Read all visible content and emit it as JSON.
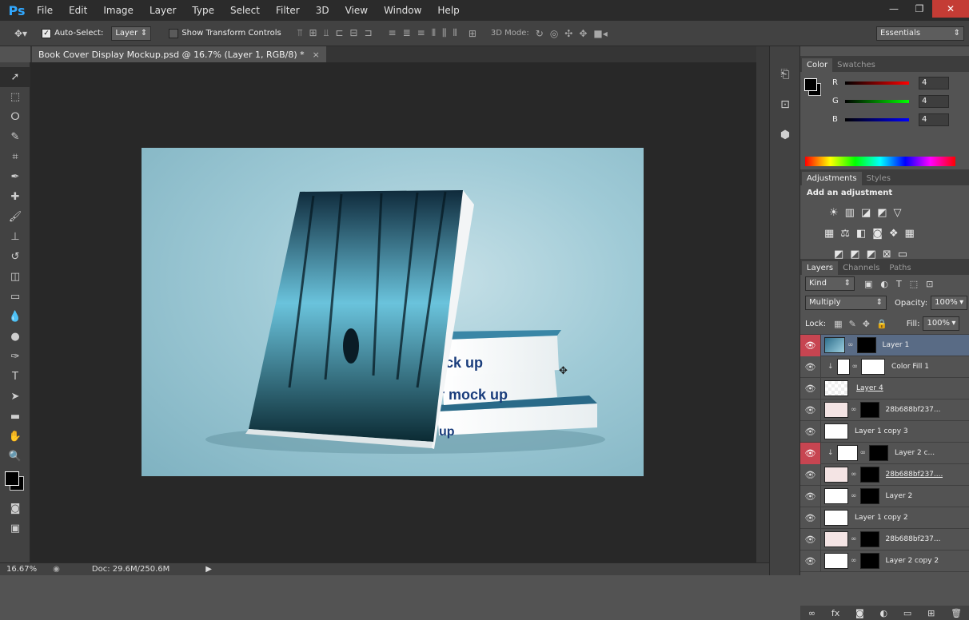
{
  "app": {
    "logo": "Ps"
  },
  "menu": [
    "File",
    "Edit",
    "Image",
    "Layer",
    "Type",
    "Select",
    "Filter",
    "3D",
    "View",
    "Window",
    "Help"
  ],
  "window_controls": {
    "minimize": "—",
    "restore": "❐",
    "close": "✕"
  },
  "options": {
    "auto_select_label": "Auto-Select:",
    "auto_select_value": "Layer",
    "show_transform_label": "Show Transform Controls",
    "mode_3d_label": "3D Mode:",
    "workspace": "Essentials"
  },
  "document": {
    "tab_title": "Book Cover Display Mockup.psd @ 16.7% (Layer 1, RGB/8) *",
    "close": "×"
  },
  "status": {
    "zoom": "16.67%",
    "doc_size": "Doc: 29.6M/250.6M"
  },
  "color_panel": {
    "tabs": [
      "Color",
      "Swatches"
    ],
    "channels": [
      {
        "label": "R",
        "value": "4",
        "color": "#e3342f"
      },
      {
        "label": "G",
        "value": "4",
        "color": "#2ecc40"
      },
      {
        "label": "B",
        "value": "4",
        "color": "#2c4bd8"
      }
    ]
  },
  "adjustments_panel": {
    "tabs": [
      "Adjustments",
      "Styles"
    ],
    "heading": "Add an adjustment"
  },
  "layers_panel": {
    "tabs": [
      "Layers",
      "Channels",
      "Paths"
    ],
    "filter_kind": "Kind",
    "blend_mode": "Multiply",
    "opacity_label": "Opacity:",
    "opacity_value": "100%",
    "lock_label": "Lock:",
    "fill_label": "Fill:",
    "fill_value": "100%",
    "layers": [
      {
        "name": "Layer 1",
        "selected": true,
        "eye_red": true
      },
      {
        "name": "Color Fill 1",
        "selected": false,
        "eye_red": false
      },
      {
        "name": "Layer 4",
        "selected": false,
        "eye_red": false
      },
      {
        "name": "28b688bf237...",
        "selected": false,
        "eye_red": false
      },
      {
        "name": "Layer 1 copy 3",
        "selected": false,
        "eye_red": false
      },
      {
        "name": "Layer 2 c...",
        "selected": false,
        "eye_red": true
      },
      {
        "name": "28b688bf237....",
        "selected": false,
        "eye_red": false
      },
      {
        "name": "Layer 2",
        "selected": false,
        "eye_red": false
      },
      {
        "name": "Layer 1 copy 2",
        "selected": false,
        "eye_red": false
      },
      {
        "name": "28b688bf237...",
        "selected": false,
        "eye_red": false
      },
      {
        "name": "Layer 2 copy 2",
        "selected": false,
        "eye_red": false
      }
    ]
  },
  "artwork": {
    "book_text_1": "ck up",
    "book_text_2": "r mock up",
    "book_text_3": "up"
  }
}
